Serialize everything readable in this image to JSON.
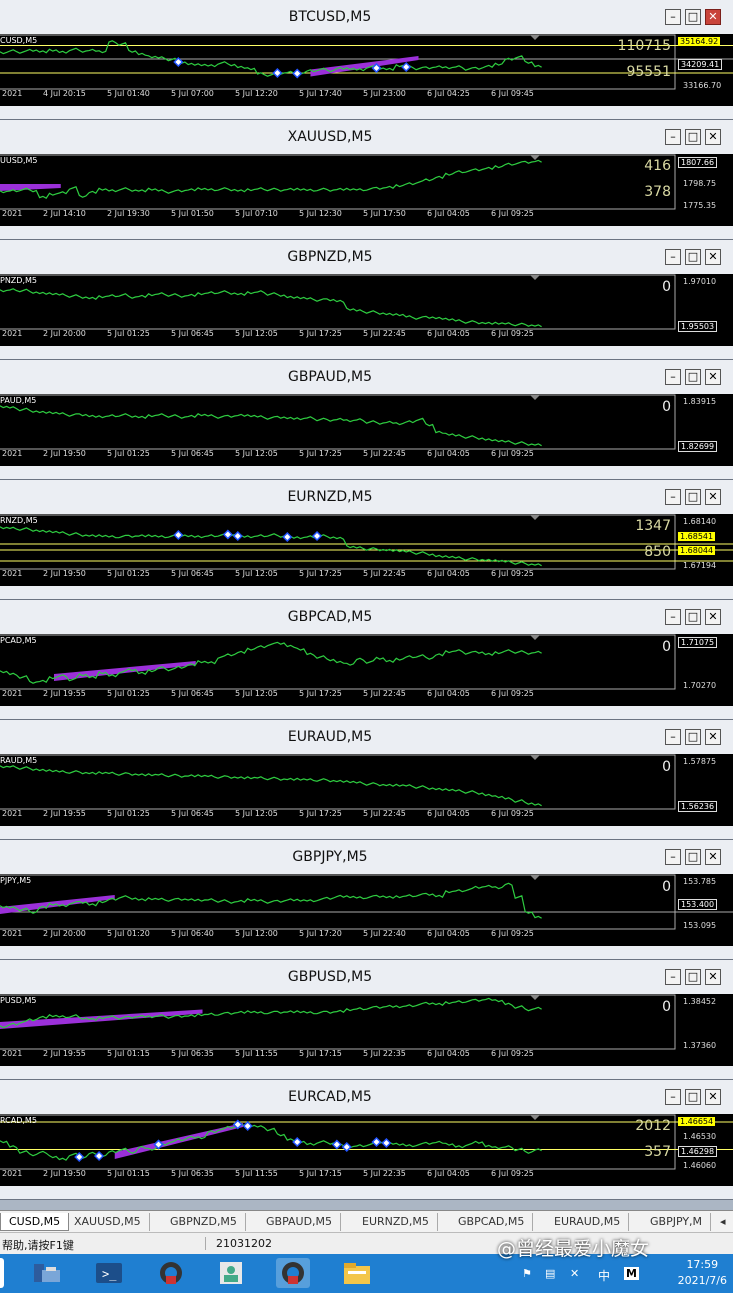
{
  "windows": [
    {
      "title": "BTCUSD,M5",
      "symbol_label": "CUSD,M5",
      "close_active": true,
      "line_color": "#2ecc40",
      "series": [
        0.68,
        0.72,
        0.7,
        0.74,
        0.71,
        0.73,
        0.69,
        0.75,
        0.72,
        0.74,
        0.7,
        0.9,
        0.86,
        0.72,
        0.66,
        0.6,
        0.58,
        0.55,
        0.5,
        0.46,
        0.44,
        0.42,
        0.48,
        0.45,
        0.4,
        0.36,
        0.26,
        0.24,
        0.28,
        0.3,
        0.27,
        0.32,
        0.35,
        0.33,
        0.38,
        0.36,
        0.34,
        0.4,
        0.38,
        0.36,
        0.42,
        0.4,
        0.37,
        0.39,
        0.41,
        0.38,
        0.4,
        0.36,
        0.38,
        0.42,
        0.45,
        0.55,
        0.6,
        0.5,
        0.42
      ],
      "ticks": [
        "2021",
        "4 Jul 20:15",
        "5 Jul 01:40",
        "5 Jul 07:00",
        "5 Jul 12:20",
        "5 Jul 17:40",
        "5 Jul 23:00",
        "6 Jul 04:25",
        "6 Jul 09:45"
      ],
      "prices": [
        {
          "text": "35164.92",
          "style": "hl"
        },
        {
          "text": "34209.41",
          "style": "box"
        },
        {
          "text": "33166.70",
          "style": "plain"
        }
      ],
      "levels": [
        {
          "text": "110715",
          "style": "yellow"
        },
        {
          "text": "95551",
          "style": "yellow"
        }
      ],
      "hlines": [
        {
          "level": 0.83,
          "color": "#ffff66"
        },
        {
          "level": 0.28,
          "color": "#ffff66"
        },
        {
          "level": 0.56,
          "color": "#aaaaaa"
        }
      ],
      "purple_bands": [
        [
          0.46,
          0.35,
          0.62,
          0.62
        ]
      ],
      "markers": [
        0.33,
        0.52,
        0.55,
        0.71,
        0.76
      ]
    },
    {
      "title": "XAUUSD,M5",
      "symbol_label": "UUSD,M5",
      "close_active": false,
      "line_color": "#2ecc40",
      "series": [
        0.3,
        0.32,
        0.35,
        0.33,
        0.2,
        0.25,
        0.28,
        0.38,
        0.22,
        0.3,
        0.35,
        0.32,
        0.36,
        0.34,
        0.33,
        0.35,
        0.32,
        0.3,
        0.33,
        0.35,
        0.36,
        0.34,
        0.36,
        0.35,
        0.33,
        0.34,
        0.36,
        0.35,
        0.34,
        0.36,
        0.35,
        0.33,
        0.35,
        0.34,
        0.36,
        0.35,
        0.34,
        0.36,
        0.38,
        0.4,
        0.42,
        0.46,
        0.5,
        0.55,
        0.6,
        0.65,
        0.7,
        0.72,
        0.75,
        0.78,
        0.8,
        0.85,
        0.88,
        0.9,
        0.92
      ],
      "ticks": [
        "2021",
        "2 Jul 14:10",
        "2 Jul 19:30",
        "5 Jul 01:50",
        "5 Jul 07:10",
        "5 Jul 12:30",
        "5 Jul 17:50",
        "6 Jul 04:05",
        "6 Jul 09:25"
      ],
      "prices": [
        {
          "text": "1807.66",
          "style": "box"
        },
        {
          "text": "1798.75",
          "style": "plain"
        },
        {
          "text": "1775.35",
          "style": "plain"
        }
      ],
      "levels": [
        {
          "text": "416",
          "style": "yellow"
        },
        {
          "text": "378",
          "style": "yellow"
        }
      ],
      "hlines": [],
      "purple_bands": [
        [
          0.0,
          0.46,
          0.09,
          0.46
        ]
      ],
      "markers": []
    },
    {
      "title": "GBPNZD,M5",
      "symbol_label": "PNZD,M5",
      "close_active": false,
      "line_color": "#2ecc40",
      "series": [
        0.72,
        0.74,
        0.73,
        0.7,
        0.68,
        0.66,
        0.64,
        0.62,
        0.6,
        0.58,
        0.6,
        0.62,
        0.64,
        0.6,
        0.62,
        0.64,
        0.66,
        0.64,
        0.62,
        0.64,
        0.66,
        0.68,
        0.7,
        0.68,
        0.66,
        0.68,
        0.7,
        0.66,
        0.64,
        0.6,
        0.58,
        0.56,
        0.54,
        0.55,
        0.52,
        0.35,
        0.32,
        0.3,
        0.28,
        0.26,
        0.24,
        0.2,
        0.18,
        0.2,
        0.18,
        0.15,
        0.12,
        0.1,
        0.09,
        0.08,
        0.07,
        0.06,
        0.05,
        0.04,
        0.03
      ],
      "ticks": [
        "2021",
        "2 Jul 20:00",
        "5 Jul 01:25",
        "5 Jul 06:45",
        "5 Jul 12:05",
        "5 Jul 17:25",
        "5 Jul 22:45",
        "6 Jul 04:05",
        "6 Jul 09:25"
      ],
      "prices": [
        {
          "text": "1.97010",
          "style": "plain"
        },
        {
          "text": "1.95503",
          "style": "box"
        }
      ],
      "levels": [
        {
          "text": "0",
          "style": "white"
        }
      ],
      "hlines": [],
      "purple_bands": [],
      "markers": []
    },
    {
      "title": "GBPAUD,M5",
      "symbol_label": "PAUD,M5",
      "close_active": false,
      "line_color": "#2ecc40",
      "series": [
        0.8,
        0.78,
        0.75,
        0.72,
        0.7,
        0.68,
        0.66,
        0.64,
        0.65,
        0.62,
        0.6,
        0.62,
        0.64,
        0.62,
        0.6,
        0.62,
        0.64,
        0.62,
        0.6,
        0.62,
        0.64,
        0.62,
        0.6,
        0.62,
        0.64,
        0.62,
        0.6,
        0.58,
        0.6,
        0.58,
        0.56,
        0.58,
        0.55,
        0.54,
        0.56,
        0.52,
        0.54,
        0.5,
        0.48,
        0.5,
        0.46,
        0.5,
        0.55,
        0.45,
        0.3,
        0.25,
        0.22,
        0.2,
        0.18,
        0.15,
        0.12,
        0.1,
        0.08,
        0.06,
        0.05
      ],
      "ticks": [
        "2021",
        "2 Jul 19:50",
        "5 Jul 01:25",
        "5 Jul 06:45",
        "5 Jul 12:05",
        "5 Jul 17:25",
        "5 Jul 22:45",
        "6 Jul 04:05",
        "6 Jul 09:25"
      ],
      "prices": [
        {
          "text": "1.83915",
          "style": "plain"
        },
        {
          "text": "1.82699",
          "style": "box"
        }
      ],
      "levels": [
        {
          "text": "0",
          "style": "white"
        }
      ],
      "hlines": [],
      "purple_bands": [],
      "markers": []
    },
    {
      "title": "EURNZD,M5",
      "symbol_label": "RNZD,M5",
      "close_active": false,
      "line_color": "#2ecc40",
      "series": [
        0.78,
        0.77,
        0.76,
        0.74,
        0.72,
        0.7,
        0.68,
        0.66,
        0.64,
        0.63,
        0.62,
        0.6,
        0.61,
        0.62,
        0.63,
        0.62,
        0.6,
        0.62,
        0.64,
        0.62,
        0.6,
        0.62,
        0.64,
        0.65,
        0.62,
        0.6,
        0.62,
        0.64,
        0.62,
        0.6,
        0.58,
        0.6,
        0.62,
        0.6,
        0.58,
        0.4,
        0.38,
        0.36,
        0.35,
        0.34,
        0.32,
        0.3,
        0.28,
        0.26,
        0.22,
        0.2,
        0.18,
        0.16,
        0.15,
        0.14,
        0.12,
        0.1,
        0.08,
        0.06,
        0.05
      ],
      "ticks": [
        "2021",
        "2 Jul 19:50",
        "5 Jul 01:25",
        "5 Jul 06:45",
        "5 Jul 12:05",
        "5 Jul 17:25",
        "5 Jul 22:45",
        "6 Jul 04:05",
        "6 Jul 09:25"
      ],
      "prices": [
        {
          "text": "1.68140",
          "style": "plain"
        },
        {
          "text": "1.68541",
          "style": "hl"
        },
        {
          "text": "1.68044",
          "style": "hl"
        },
        {
          "text": "1.67194",
          "style": "plain"
        }
      ],
      "levels": [
        {
          "text": "1347",
          "style": "yellow"
        },
        {
          "text": "850",
          "style": "yellow"
        }
      ],
      "hlines": [
        {
          "level": 0.46,
          "color": "#ffff66"
        },
        {
          "level": 0.34,
          "color": "#ffff66"
        },
        {
          "level": 0.12,
          "color": "#ffff66"
        }
      ],
      "purple_bands": [],
      "markers": [
        0.34,
        0.43,
        0.45,
        0.53,
        0.59
      ]
    },
    {
      "title": "GBPCAD,M5",
      "symbol_label": "PCAD,M5",
      "close_active": false,
      "line_color": "#2ecc40",
      "series": [
        0.3,
        0.25,
        0.2,
        0.1,
        0.12,
        0.18,
        0.22,
        0.15,
        0.25,
        0.2,
        0.28,
        0.22,
        0.3,
        0.35,
        0.28,
        0.32,
        0.38,
        0.35,
        0.4,
        0.45,
        0.5,
        0.48,
        0.6,
        0.65,
        0.7,
        0.75,
        0.8,
        0.85,
        0.88,
        0.82,
        0.75,
        0.65,
        0.6,
        0.55,
        0.5,
        0.45,
        0.55,
        0.5,
        0.58,
        0.52,
        0.55,
        0.6,
        0.62,
        0.58,
        0.65,
        0.7,
        0.72,
        0.68,
        0.7,
        0.66,
        0.68,
        0.72,
        0.7,
        0.68,
        0.7
      ],
      "ticks": [
        "2021",
        "2 Jul 19:55",
        "5 Jul 01:25",
        "5 Jul 06:45",
        "5 Jul 12:05",
        "5 Jul 17:25",
        "5 Jul 22:45",
        "6 Jul 04:05",
        "6 Jul 09:25"
      ],
      "prices": [
        {
          "text": "1.71075",
          "style": "box"
        },
        {
          "text": "1.70270",
          "style": "plain"
        }
      ],
      "levels": [
        {
          "text": "0",
          "style": "white"
        }
      ],
      "hlines": [],
      "purple_bands": [
        [
          0.08,
          0.26,
          0.29,
          0.52
        ]
      ],
      "markers": []
    },
    {
      "title": "EURAUD,M5",
      "symbol_label": "RAUD,M5",
      "close_active": false,
      "line_color": "#2ecc40",
      "series": [
        0.8,
        0.8,
        0.78,
        0.76,
        0.74,
        0.72,
        0.7,
        0.7,
        0.69,
        0.68,
        0.68,
        0.67,
        0.66,
        0.66,
        0.65,
        0.64,
        0.64,
        0.63,
        0.62,
        0.63,
        0.62,
        0.61,
        0.6,
        0.6,
        0.59,
        0.58,
        0.58,
        0.57,
        0.56,
        0.56,
        0.55,
        0.54,
        0.54,
        0.53,
        0.52,
        0.5,
        0.48,
        0.46,
        0.45,
        0.44,
        0.43,
        0.42,
        0.4,
        0.38,
        0.36,
        0.34,
        0.32,
        0.3,
        0.28,
        0.24,
        0.2,
        0.16,
        0.12,
        0.08,
        0.05
      ],
      "ticks": [
        "2021",
        "2 Jul 19:55",
        "5 Jul 01:25",
        "5 Jul 06:45",
        "5 Jul 12:05",
        "5 Jul 17:25",
        "5 Jul 22:45",
        "6 Jul 04:05",
        "6 Jul 09:25"
      ],
      "prices": [
        {
          "text": "1.57875",
          "style": "plain"
        },
        {
          "text": "1.56236",
          "style": "box"
        }
      ],
      "levels": [
        {
          "text": "0",
          "style": "white"
        }
      ],
      "hlines": [],
      "purple_bands": [],
      "markers": []
    },
    {
      "title": "GBPJPY,M5",
      "symbol_label": "PJPY,M5",
      "close_active": false,
      "line_color": "#2ecc40",
      "series": [
        0.4,
        0.38,
        0.35,
        0.3,
        0.4,
        0.45,
        0.42,
        0.48,
        0.5,
        0.45,
        0.5,
        0.55,
        0.6,
        0.58,
        0.55,
        0.56,
        0.55,
        0.54,
        0.56,
        0.55,
        0.53,
        0.54,
        0.52,
        0.5,
        0.52,
        0.54,
        0.52,
        0.5,
        0.52,
        0.55,
        0.53,
        0.52,
        0.55,
        0.58,
        0.62,
        0.6,
        0.58,
        0.6,
        0.62,
        0.6,
        0.6,
        0.62,
        0.64,
        0.66,
        0.62,
        0.7,
        0.72,
        0.75,
        0.8,
        0.82,
        0.78,
        0.85,
        0.6,
        0.3,
        0.2
      ],
      "ticks": [
        "2021",
        "2 Jul 20:00",
        "5 Jul 01:20",
        "5 Jul 06:40",
        "5 Jul 12:00",
        "5 Jul 17:20",
        "5 Jul 22:40",
        "6 Jul 04:05",
        "6 Jul 09:25"
      ],
      "prices": [
        {
          "text": "153.785",
          "style": "plain"
        },
        {
          "text": "153.400",
          "style": "box"
        },
        {
          "text": "153.095",
          "style": "plain"
        }
      ],
      "levels": [
        {
          "text": "0",
          "style": "white"
        }
      ],
      "hlines": [
        {
          "level": 0.3,
          "color": "#aaaaaa"
        }
      ],
      "purple_bands": [
        [
          0.0,
          0.4,
          0.17,
          0.64
        ]
      ],
      "markers": []
    },
    {
      "title": "GBPUSD,M5",
      "symbol_label": "PUSD,M5",
      "close_active": false,
      "line_color": "#2ecc40",
      "series": [
        0.4,
        0.45,
        0.5,
        0.55,
        0.6,
        0.62,
        0.6,
        0.62,
        0.58,
        0.56,
        0.58,
        0.6,
        0.58,
        0.6,
        0.62,
        0.6,
        0.62,
        0.6,
        0.62,
        0.63,
        0.64,
        0.65,
        0.66,
        0.68,
        0.7,
        0.7,
        0.68,
        0.69,
        0.7,
        0.71,
        0.7,
        0.68,
        0.69,
        0.7,
        0.72,
        0.74,
        0.76,
        0.78,
        0.8,
        0.82,
        0.8,
        0.82,
        0.85,
        0.88,
        0.86,
        0.88,
        0.9,
        0.92,
        0.94,
        0.96,
        0.92,
        0.85,
        0.8,
        0.75,
        0.78
      ],
      "ticks": [
        "2021",
        "2 Jul 19:55",
        "5 Jul 01:15",
        "5 Jul 06:35",
        "5 Jul 11:55",
        "5 Jul 17:15",
        "5 Jul 22:35",
        "6 Jul 04:05",
        "6 Jul 09:25"
      ],
      "prices": [
        {
          "text": "1.38452",
          "style": "plain"
        },
        {
          "text": "1.37360",
          "style": "plain"
        }
      ],
      "levels": [
        {
          "text": "0",
          "style": "white"
        }
      ],
      "hlines": [],
      "purple_bands": [
        [
          0.0,
          0.5,
          0.3,
          0.75
        ]
      ],
      "markers": []
    },
    {
      "title": "EURCAD,M5",
      "symbol_label": "RCAD,M5",
      "close_active": false,
      "line_color": "#2ecc40",
      "series": [
        0.5,
        0.4,
        0.3,
        0.25,
        0.3,
        0.2,
        0.15,
        0.25,
        0.2,
        0.28,
        0.22,
        0.3,
        0.35,
        0.3,
        0.4,
        0.35,
        0.45,
        0.5,
        0.55,
        0.6,
        0.58,
        0.7,
        0.75,
        0.8,
        0.85,
        0.82,
        0.8,
        0.75,
        0.65,
        0.55,
        0.5,
        0.45,
        0.5,
        0.48,
        0.45,
        0.4,
        0.42,
        0.45,
        0.5,
        0.48,
        0.45,
        0.42,
        0.45,
        0.48,
        0.5,
        0.45,
        0.4,
        0.45,
        0.5,
        0.42,
        0.38,
        0.4,
        0.35,
        0.3,
        0.35
      ],
      "ticks": [
        "2021",
        "2 Jul 19:50",
        "5 Jul 01:15",
        "5 Jul 06:35",
        "5 Jul 11:55",
        "5 Jul 17:15",
        "5 Jul 22:35",
        "6 Jul 04:05",
        "6 Jul 09:25"
      ],
      "prices": [
        {
          "text": "1.46654",
          "style": "hl"
        },
        {
          "text": "1.46530",
          "style": "plain"
        },
        {
          "text": "1.46298",
          "style": "box"
        },
        {
          "text": "1.46060",
          "style": "plain"
        }
      ],
      "levels": [
        {
          "text": "2012",
          "style": "yellow"
        },
        {
          "text": "357",
          "style": "yellow"
        }
      ],
      "hlines": [
        {
          "level": 0.9,
          "color": "#ffff66"
        },
        {
          "level": 0.35,
          "color": "#ffff66"
        }
      ],
      "purple_bands": [
        [
          0.17,
          0.3,
          0.36,
          0.88
        ]
      ],
      "markers": [
        0.14,
        0.18,
        0.29,
        0.3,
        0.45,
        0.47,
        0.55,
        0.63,
        0.64,
        0.7,
        0.72
      ]
    }
  ],
  "tabs": [
    "CUSD,M5",
    "XAUUSD,M5",
    "GBPNZD,M5",
    "GBPAUD,M5",
    "EURNZD,M5",
    "GBPCAD,M5",
    "EURAUD,M5",
    "GBPJPY,M"
  ],
  "status": {
    "help": "帮助,请按F1键",
    "code": "21031202"
  },
  "watermark": "@曾经最爱小魔女",
  "tray": {
    "ime": "中",
    "mode": "M",
    "time": "17:59",
    "date": "2021/7/6"
  },
  "window_buttons": {
    "min": "–",
    "max": "□",
    "close": "✕"
  }
}
